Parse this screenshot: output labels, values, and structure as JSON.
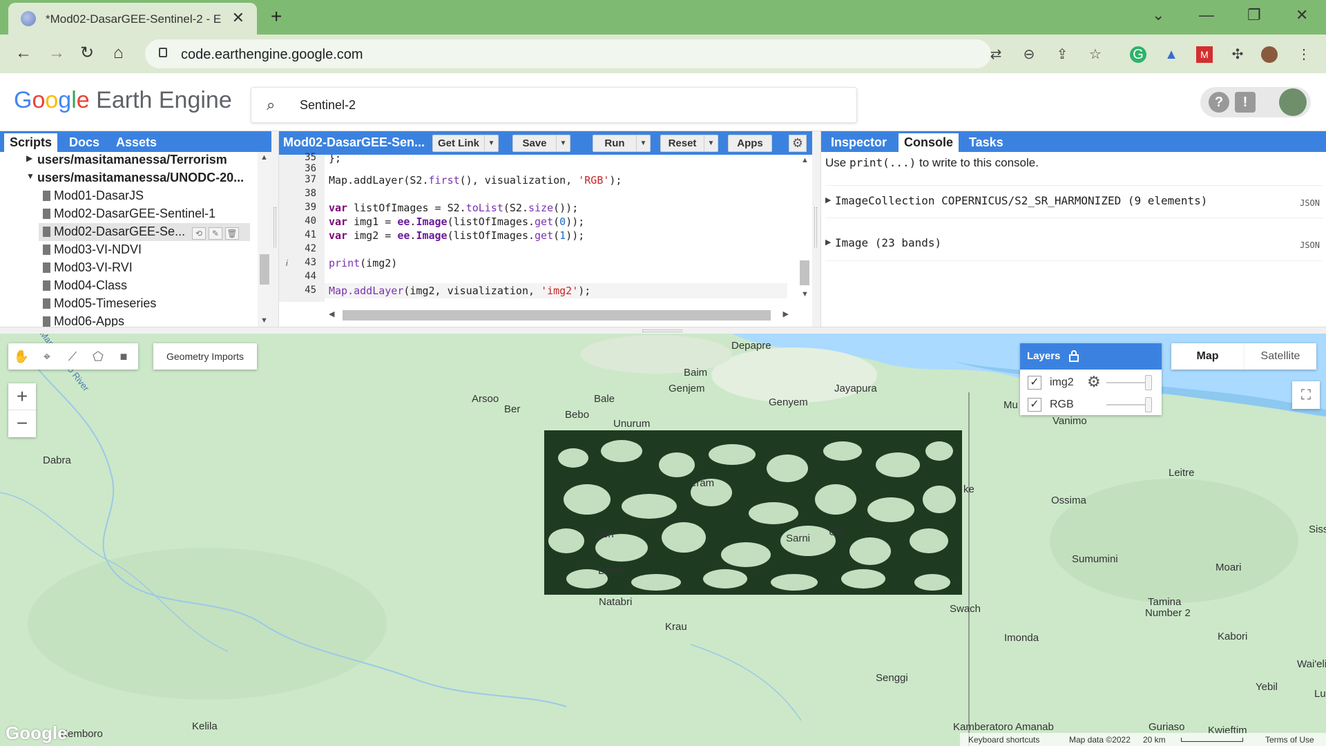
{
  "browser": {
    "tab_title": "*Mod02-DasarGEE-Sentinel-2 - E",
    "url": "code.earthengine.google.com",
    "new_tab": "+",
    "close": "✕"
  },
  "gee": {
    "logo_google": [
      "G",
      "o",
      "o",
      "g",
      "l",
      "e"
    ],
    "logo_rest": "Earth Engine",
    "search_value": "Sentinel-2",
    "help": "?",
    "feedback": "!"
  },
  "left_panel": {
    "tabs": [
      "Scripts",
      "Docs",
      "Assets"
    ],
    "tree": [
      {
        "label": "users/masitamanessa/Terrorism",
        "kind": "folder",
        "expanded": false
      },
      {
        "label": "users/masitamanessa/UNODC-20...",
        "kind": "folder",
        "expanded": true
      },
      {
        "label": "Mod01-DasarJS",
        "kind": "file"
      },
      {
        "label": "Mod02-DasarGEE-Sentinel-1",
        "kind": "file"
      },
      {
        "label": "Mod02-DasarGEE-Se...",
        "kind": "file",
        "selected": true
      },
      {
        "label": "Mod03-VI-NDVI",
        "kind": "file"
      },
      {
        "label": "Mod03-VI-RVI",
        "kind": "file"
      },
      {
        "label": "Mod04-Class",
        "kind": "file"
      },
      {
        "label": "Mod05-Timeseries",
        "kind": "file"
      },
      {
        "label": "Mod06-Apps",
        "kind": "file"
      }
    ]
  },
  "editor": {
    "script_name": "Mod02-DasarGEE-Sen...",
    "buttons": {
      "get_link": "Get Link",
      "save": "Save",
      "run": "Run",
      "reset": "Reset",
      "apps": "Apps"
    },
    "line_numbers": [
      "35",
      "36",
      "37",
      "38",
      "39",
      "40",
      "41",
      "42",
      "43",
      "44",
      "45"
    ],
    "info_marker": "i",
    "lines": {
      "l35": "};",
      "l37a": "Map.addLayer(S2.",
      "l37b": "first",
      "l37c": "(), visualization, ",
      "l37d": "'RGB'",
      "l37e": ");",
      "l39a": "var",
      "l39b": " listOfImages = S2.",
      "l39c": "toList",
      "l39d": "(S2.",
      "l39e": "size",
      "l39f": "());",
      "l40a": "var",
      "l40b": " img1 = ",
      "l40c": "ee",
      "l40d": ".",
      "l40e": "Image",
      "l40f": "(listOfImages.",
      "l40g": "get",
      "l40h": "(",
      "l40i": "0",
      "l40j": "));",
      "l41a": "var",
      "l41b": " img2 = ",
      "l41c": "ee",
      "l41d": ".",
      "l41e": "Image",
      "l41f": "(listOfImages.",
      "l41g": "get",
      "l41h": "(",
      "l41i": "1",
      "l41j": "));",
      "l43a": "print",
      "l43b": "(img2)",
      "l45a": "Map.addLayer",
      "l45b": "(img2, visualization, ",
      "l45c": "'img2'",
      "l45d": ");"
    }
  },
  "right_panel": {
    "tabs": [
      "Inspector",
      "Console",
      "Tasks"
    ],
    "hint_pre": "Use ",
    "hint_code": "print(...)",
    "hint_post": " to write to this console.",
    "entries": [
      {
        "text": "ImageCollection COPERNICUS/S2_SR_HARMONIZED (9 elements)",
        "badge": "JSON"
      },
      {
        "text": "Image (23 bands)",
        "badge": "JSON"
      }
    ]
  },
  "map": {
    "geometry_imports": "Geometry Imports",
    "zoom_in": "+",
    "zoom_out": "−",
    "layers_title": "Layers",
    "layers": [
      {
        "name": "img2",
        "checked": true
      },
      {
        "name": "RGB",
        "checked": true
      }
    ],
    "map_type": [
      "Map",
      "Satellite"
    ],
    "labels": {
      "depapre": "Depapre",
      "baim": "Baim",
      "genjem": "Genjem",
      "jayapura": "Jayapura",
      "genyem": "Genyem",
      "arsoo": "Arsoo",
      "ber": "Ber",
      "bale": "Bale",
      "bebo": "Bebo",
      "unurum": "Unurum",
      "vanimo": "Vanimo",
      "mu": "Mu",
      "dabra": "Dabra",
      "river": "Mamberamo River",
      "leitre": "Leitre",
      "ossima": "Ossima",
      "ke": "ke",
      "siss": "Siss",
      "sumumini": "Sumumini",
      "moari": "Moari",
      "natabri": "Natabri",
      "swach": "Swach",
      "tamina": "Tamina",
      "number2": "Number 2",
      "krau": "Krau",
      "imonda": "Imonda",
      "kabori": "Kabori",
      "waiel": "Wai'eli",
      "yebil": "Yebil",
      "lu": "Lu",
      "senggi": "Senggi",
      "kelila": "Kelila",
      "kemboro": "Kemboro",
      "kamberatoro": "Kamberatoro",
      "amanab": "Amanab",
      "guriaso": "Guriaso",
      "kwieftim": "Kwieftim",
      "lereh": "Lereh",
      "sen": "Sen",
      "sarni": "Sarni",
      "ute": "Ute",
      "eram": "eram"
    },
    "footer": {
      "shortcuts": "Keyboard shortcuts",
      "data": "Map data ©2022",
      "scale": "20 km",
      "terms": "Terms of Use"
    },
    "watermark": "Google"
  }
}
